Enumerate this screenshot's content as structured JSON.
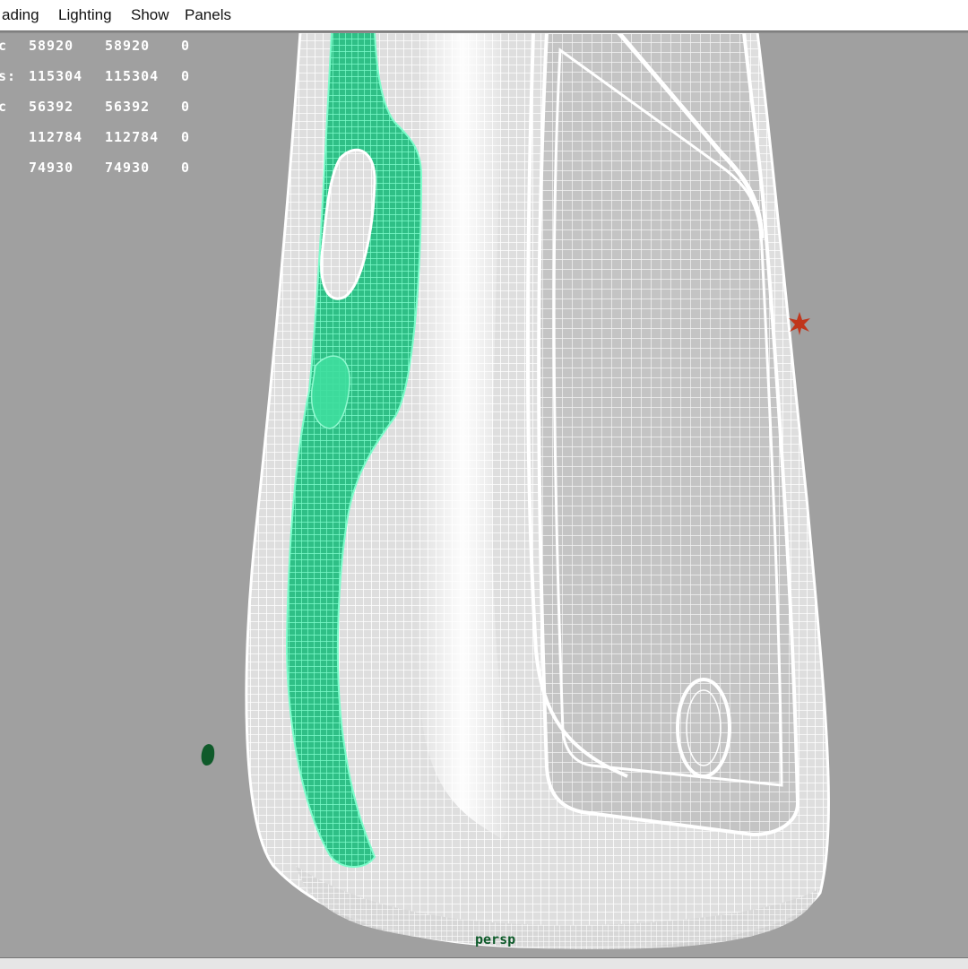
{
  "menu": {
    "items": [
      "ading",
      "Lighting",
      "Show",
      "Panels"
    ]
  },
  "hud": {
    "rows": [
      {
        "label": "c",
        "values": [
          "58920",
          "58920",
          "0"
        ]
      },
      {
        "label": "s:",
        "values": [
          "115304",
          "115304",
          "0"
        ]
      },
      {
        "label": "c",
        "values": [
          "56392",
          "56392",
          "0"
        ]
      },
      {
        "label": "",
        "values": [
          "112784",
          "112784",
          "0"
        ]
      },
      {
        "label": "",
        "values": [
          "74930",
          "74930",
          "0"
        ]
      }
    ]
  },
  "viewport": {
    "camera_label": "persp",
    "background_color": "#a0a0a0",
    "wireframe_color": "#ffffff",
    "selection_color": "#3fe6a0"
  },
  "icons": {
    "light_locator": "sun-locator-icon",
    "pivot_marker": "pivot-icon"
  }
}
